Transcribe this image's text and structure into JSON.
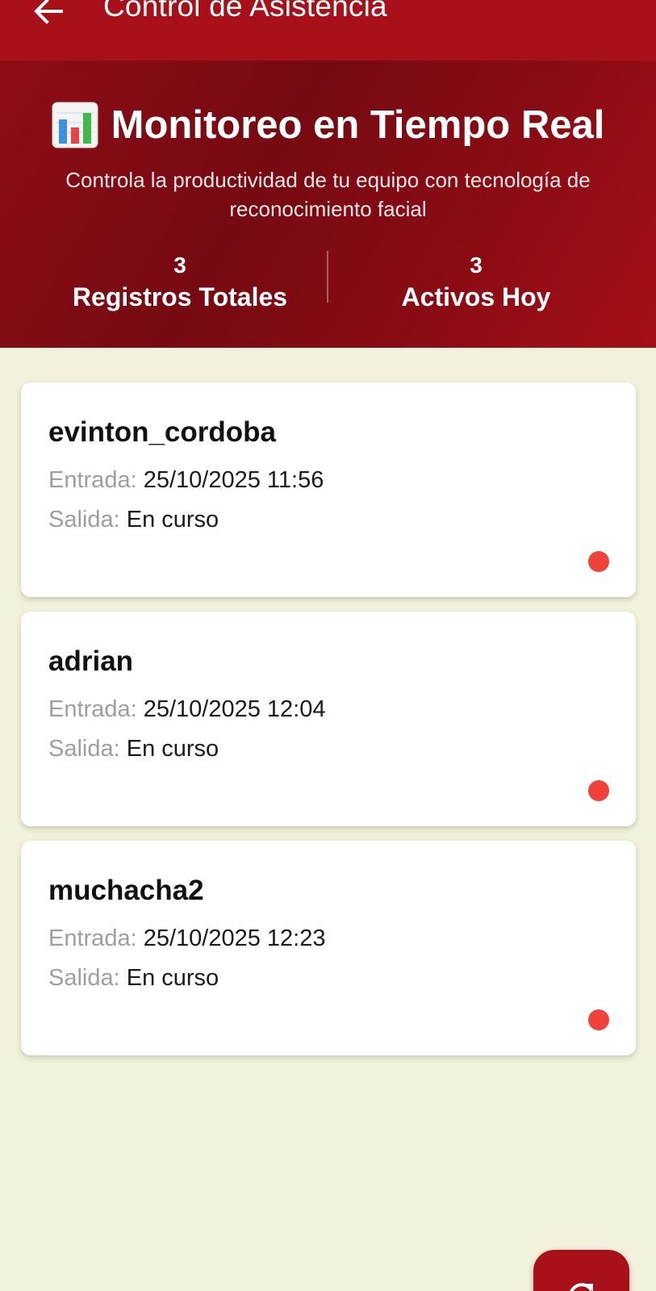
{
  "appbar": {
    "title": "Control de Asistencia",
    "back_icon": "arrow-left-icon"
  },
  "hero": {
    "icon": "bar-chart-icon",
    "title": "Monitoreo en Tiempo Real",
    "subtitle": "Controla la productividad de tu equipo con tecnología de reconocimiento facial",
    "stats": [
      {
        "value": "3",
        "label": "Registros Totales"
      },
      {
        "value": "3",
        "label": "Activos Hoy"
      }
    ]
  },
  "records": [
    {
      "name": "evinton_cordoba",
      "entrada_label": "Entrada:",
      "entrada": "25/10/2025 11:56",
      "salida_label": "Salida:",
      "salida": "En curso"
    },
    {
      "name": "adrian",
      "entrada_label": "Entrada:",
      "entrada": "25/10/2025 12:04",
      "salida_label": "Salida:",
      "salida": "En curso"
    },
    {
      "name": "muchacha2",
      "entrada_label": "Entrada:",
      "entrada": "25/10/2025 12:23",
      "salida_label": "Salida:",
      "salida": "En curso"
    }
  ],
  "fab": {
    "icon": "refresh-icon"
  },
  "colors": {
    "primary": "#A8101A",
    "background": "#F2F2DC",
    "status_active": "#F0423A"
  }
}
